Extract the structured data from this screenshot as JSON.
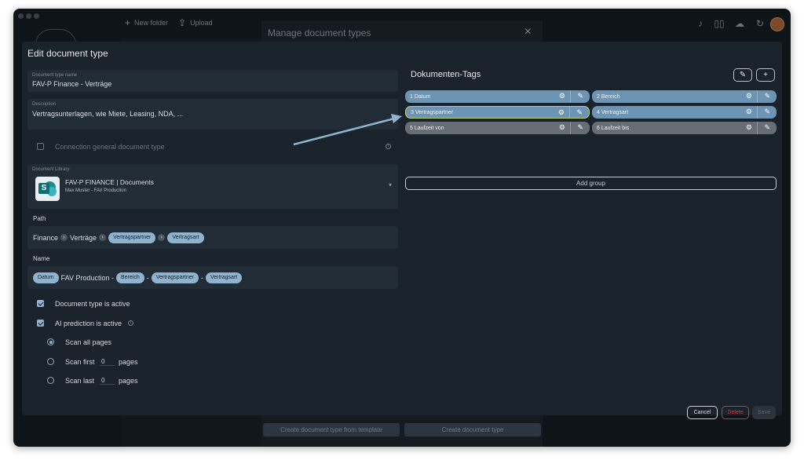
{
  "topbar": {
    "new_folder_label": "New folder",
    "upload_label": "Upload"
  },
  "manage_dialog": {
    "title": "Manage document types",
    "close_label": "×",
    "template_button": "Create document type from template",
    "create_button": "Create document type"
  },
  "editor": {
    "title": "Edit document type",
    "name_field": {
      "label": "Document type name",
      "value": "FAV-P Finance - Verträge"
    },
    "description_field": {
      "label": "Description",
      "value": "Vertragsunterlagen, wie Miete, Leasing, NDA, ..."
    },
    "connection_label": "Connection general document type",
    "info_glyph": "i",
    "library": {
      "label": "Document Library",
      "name": "FAV-P FINANCE | Documents",
      "subtitle": "Max Muster - FAV Production",
      "icon_letter": "S",
      "caret": "▾"
    },
    "path": {
      "label": "Path",
      "segments": [
        "Finance",
        "Verträge"
      ],
      "chips": [
        "Vertragspartner",
        "Vertragsart"
      ],
      "separator": "›"
    },
    "name": {
      "label": "Name",
      "chip_datum": "Datum",
      "text": "FAV Production -",
      "chip_bereich": "Bereich",
      "dash": "-",
      "chip_partner": "Vertragspartner",
      "chip_art": "Vertragsart"
    },
    "active_label": "Document type is active",
    "ai_label": "AI prediction is active",
    "scan_all_label": "Scan all pages",
    "scan_first_label": "Scan first",
    "scan_last_label": "Scan last",
    "pages_label": "pages",
    "first_value": "0",
    "last_value": "0"
  },
  "tags_panel": {
    "title": "Dokumenten-Tags",
    "edit_button": "✎",
    "add_button": "+",
    "tags": [
      {
        "label": "1  Datum"
      },
      {
        "label": "2  Bereich"
      },
      {
        "label": "3  Vertragspartner"
      },
      {
        "label": "4  Vertragsart"
      },
      {
        "label": "5  Laufzeit von"
      },
      {
        "label": "6  Laufzeit bis"
      }
    ],
    "add_group_label": "Add group"
  },
  "footer": {
    "cancel": "Cancel",
    "delete": "Delete",
    "save": "Save"
  },
  "colors": {
    "accent": "#8fb3cf",
    "tag_blue": "#6e94b3",
    "tag_grey": "#666d75",
    "selected_border": "#b8d46a",
    "delete_red": "#c23a3a"
  }
}
